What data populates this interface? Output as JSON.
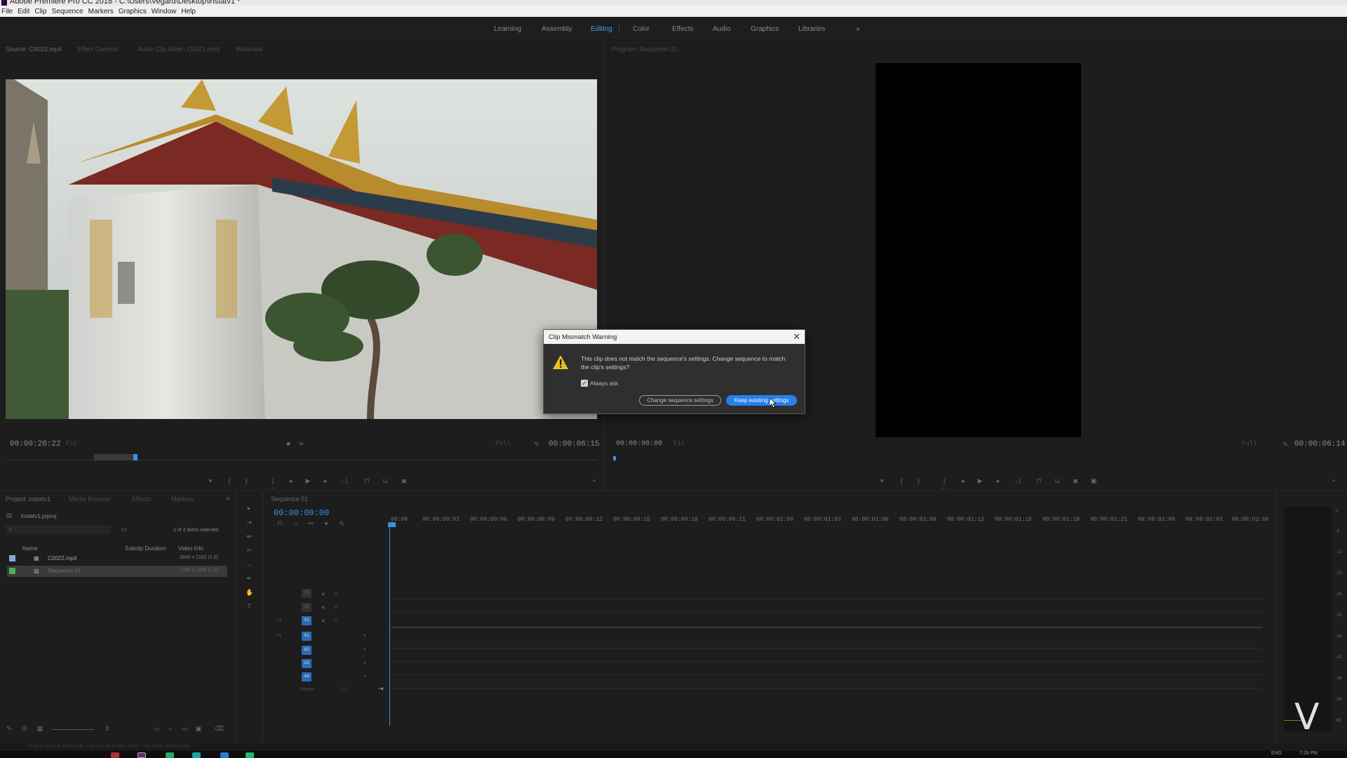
{
  "window": {
    "title": "Adobe Premiere Pro CC 2018 - C:\\Users\\Vegard\\Desktop\\instatv1 *"
  },
  "menu": [
    "File",
    "Edit",
    "Clip",
    "Sequence",
    "Markers",
    "Graphics",
    "Window",
    "Help"
  ],
  "workspaces": {
    "items": [
      "Learning",
      "Assembly",
      "Editing",
      "Color",
      "Effects",
      "Audio",
      "Graphics",
      "Libraries"
    ],
    "active": "Editing",
    "more": "»"
  },
  "source_monitor": {
    "tabs": [
      "Source: C0022.mp4",
      "Effect Controls",
      "Audio Clip Mixer: C0022.mp4",
      "Metadata"
    ],
    "timecode_in": "00:00:20:22",
    "fit": "Fit",
    "resolution": "Full",
    "duration": "00:00:06:15"
  },
  "program_monitor": {
    "tab": "Program: Sequence 01",
    "timecode": "00:00:00:00",
    "fit": "Fit",
    "resolution": "Full",
    "duration": "00:00:06:14"
  },
  "dialog": {
    "title": "Clip Mismatch Warning",
    "message": "This clip does not match the sequence's settings. Change sequence to match the clip's settings?",
    "checkbox_label": "Always ask",
    "checkbox_checked": true,
    "buttons": {
      "change": "Change sequence settings",
      "keep": "Keep existing settings"
    }
  },
  "project": {
    "tabs": [
      "Project: instatv1",
      "Media Browser",
      "Effects",
      "Markers"
    ],
    "file": "instatv1.prproj",
    "selection": "1 of 2 items selected",
    "columns": [
      "Name",
      "Subclip Duration",
      "Video Info"
    ],
    "items": [
      {
        "name": "C0022.mp4",
        "info": "3840 x 2160 (1.0)",
        "color": "#8aa6d8"
      },
      {
        "name": "Sequence 01",
        "info": "1080 x 1920 (1.0)",
        "color": "#4caf50"
      }
    ]
  },
  "timeline": {
    "tab": "Sequence 01",
    "timecode": "00:00:00:00",
    "ruler": [
      "00:00",
      "00:00:00:03",
      "00:00:00:06",
      "00:00:00:09",
      "00:00:00:12",
      "00:00:00:15",
      "00:00:00:18",
      "00:00:00:21",
      "00:00:01:00",
      "00:00:01:03",
      "00:00:01:06",
      "00:00:01:09",
      "00:00:01:12",
      "00:00:01:15",
      "00:00:01:18",
      "00:00:01:21",
      "00:00:02:00",
      "00:00:02:03",
      "00:00:02:06"
    ],
    "video_tracks": [
      "V3",
      "V2",
      "V1"
    ],
    "audio_tracks": [
      "A1",
      "A2",
      "A3",
      "A4"
    ],
    "master": "Master",
    "master_value": "0.0"
  },
  "meter_scale": [
    "0",
    "-6",
    "-12",
    "-18",
    "-24",
    "-30",
    "-36",
    "-42",
    "-48",
    "-54",
    "dB"
  ],
  "status": {
    "hint": "Drop in track to Overwrite. Use Ctrl to enable Insert. Use Alt to replace clip."
  },
  "taskbar": {
    "lang": "ENG",
    "time": "7:28 PM"
  },
  "watermark": "V",
  "icons": [
    "warning-icon",
    "close-icon",
    "play-icon",
    "step-back-icon",
    "step-forward-icon",
    "marker-icon",
    "wrench-icon",
    "selection-tool-icon",
    "razor-tool-icon",
    "hand-tool-icon",
    "type-tool-icon",
    "search-icon",
    "folder-icon"
  ]
}
